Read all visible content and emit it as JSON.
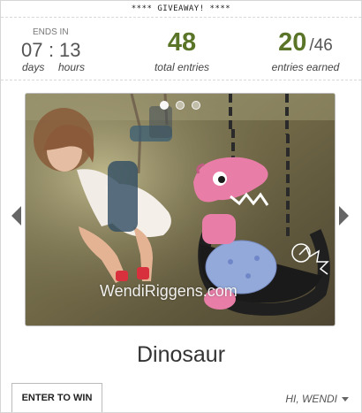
{
  "banner": "**** GIVEAWAY! ****",
  "countdown": {
    "label": "ENDS IN",
    "days": "07",
    "separator": ":",
    "hours": "13",
    "days_label": "days",
    "hours_label": "hours"
  },
  "total_entries": {
    "value": "48",
    "label": "total entries"
  },
  "entries_earned": {
    "earned": "20",
    "separator": "/",
    "total": "46",
    "label": "entries earned"
  },
  "slideshow": {
    "watermark": "WendiRiggens.com",
    "dots": 3,
    "active_dot": 0
  },
  "prize": {
    "title": "Dinosaur"
  },
  "footer": {
    "enter_tab": "ENTER TO WIN",
    "user_greeting": "HI, WENDI"
  },
  "colors": {
    "accent_green": "#5a7527",
    "border": "#d6d6d6"
  }
}
